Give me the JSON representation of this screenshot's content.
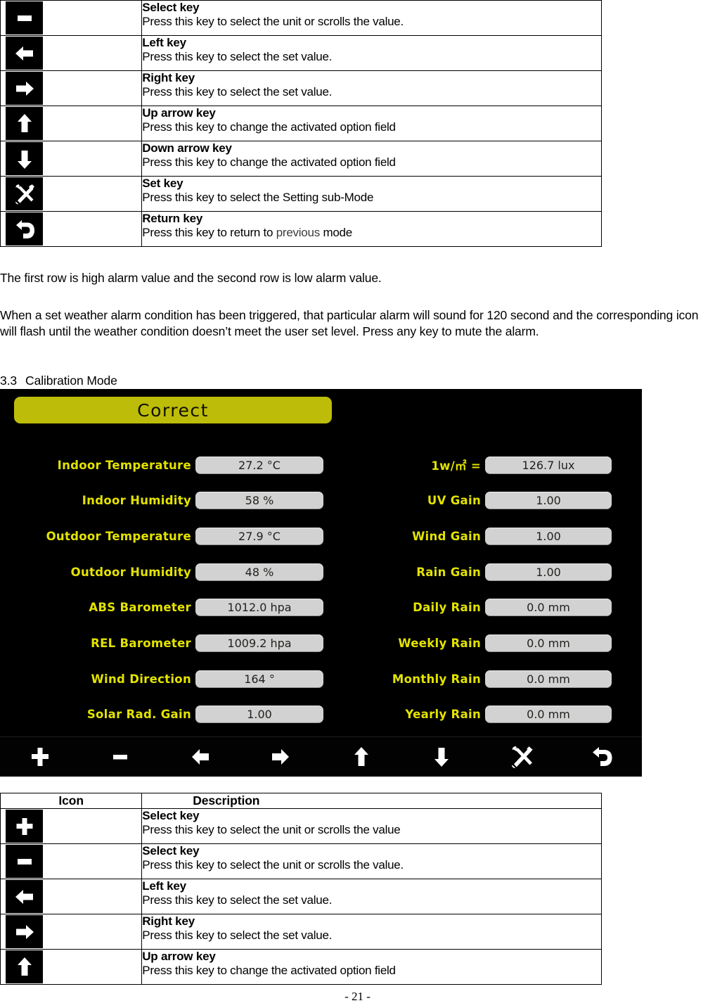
{
  "top_table": {
    "rows": [
      {
        "icon": "minus-key-icon",
        "title": "Select key",
        "desc": "Press this key to select the unit or scrolls the value."
      },
      {
        "icon": "left-arrow-key-icon",
        "title": "Left key",
        "desc": "Press this key to select the set value."
      },
      {
        "icon": "right-arrow-key-icon",
        "title": "Right key",
        "desc": "Press this key to select the set value."
      },
      {
        "icon": "up-arrow-key-icon",
        "title": "Up arrow key",
        "desc": "Press this key to change the activated option field"
      },
      {
        "icon": "down-arrow-key-icon",
        "title": "Down arrow key",
        "desc": "Press this key to change the activated option field"
      },
      {
        "icon": "set-tools-key-icon",
        "title": "Set key",
        "desc": "Press this key to select the Setting sub-Mode"
      },
      {
        "icon": "return-key-icon",
        "title": "Return key",
        "desc_pre": "Press this key to return to ",
        "desc_mid": "previous",
        "desc_post": " mode"
      }
    ]
  },
  "paragraphs": {
    "p1": "The first row is high alarm value and the second row is low alarm value.",
    "p2": "When a set weather alarm condition has been triggered, that particular alarm will sound for 120 second and the corresponding icon will flash until the weather condition doesn’t meet the user set level. Press any key to mute the alarm."
  },
  "heading": {
    "number": "3.3",
    "text": "Calibration Mode"
  },
  "lcd": {
    "banner": "Correct",
    "left_rows": [
      {
        "label": "Indoor Temperature",
        "value": "27.2 °C"
      },
      {
        "label": "Indoor Humidity",
        "value": "58 %"
      },
      {
        "label": "Outdoor Temperature",
        "value": "27.9 °C"
      },
      {
        "label": "Outdoor Humidity",
        "value": "48 %"
      },
      {
        "label": "ABS Barometer",
        "value": "1012.0 hpa"
      },
      {
        "label": "REL Barometer",
        "value": "1009.2 hpa"
      },
      {
        "label": "Wind Direction",
        "value": "164 °"
      },
      {
        "label": "Solar Rad. Gain",
        "value": "1.00"
      }
    ],
    "right_rows": [
      {
        "label": "1w/㎡ =",
        "value": "126.7 lux"
      },
      {
        "label": "UV Gain",
        "value": "1.00"
      },
      {
        "label": "Wind Gain",
        "value": "1.00"
      },
      {
        "label": "Rain Gain",
        "value": "1.00"
      },
      {
        "label": "Daily Rain",
        "value": "0.0 mm"
      },
      {
        "label": "Weekly Rain",
        "value": "0.0 mm"
      },
      {
        "label": "Monthly Rain",
        "value": "0.0 mm"
      },
      {
        "label": "Yearly Rain",
        "value": "0.0 mm"
      }
    ],
    "keybar": [
      "plus-key-icon",
      "minus-key-icon",
      "left-arrow-key-icon",
      "right-arrow-key-icon",
      "up-arrow-key-icon",
      "down-arrow-key-icon",
      "set-tools-key-icon",
      "return-key-icon"
    ],
    "colors": {
      "background": "#000000",
      "banner": "#bdbd09",
      "label": "#e3e300",
      "value_pill": "#d2d2d2"
    }
  },
  "bottom_table": {
    "header": {
      "icon": "Icon",
      "description": "Description"
    },
    "rows": [
      {
        "icon": "plus-key-icon",
        "title": "Select key",
        "desc": "Press this key to select the unit or scrolls the value"
      },
      {
        "icon": "minus-key-icon",
        "title": "Select key",
        "desc": "Press this key to select the unit or scrolls the value."
      },
      {
        "icon": "left-arrow-key-icon",
        "title": "Left key",
        "desc": "Press this key to select the set value."
      },
      {
        "icon": "right-arrow-key-icon",
        "title": "Right key",
        "desc": "Press this key to select the set value."
      },
      {
        "icon": "up-arrow-key-icon",
        "title": "Up arrow key",
        "desc": "Press this key to change the activated option field"
      }
    ]
  },
  "footer": "- 21 -"
}
